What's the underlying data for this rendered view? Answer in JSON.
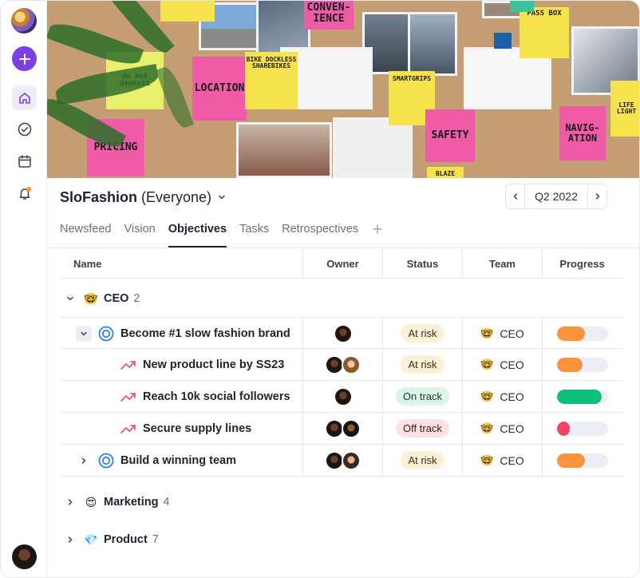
{
  "project": {
    "name": "SloFashion",
    "scope": "(Everyone)"
  },
  "period": {
    "label": "Q2 2022"
  },
  "tabs": [
    {
      "label": "Newsfeed"
    },
    {
      "label": "Vision"
    },
    {
      "label": "Objectives",
      "active": true
    },
    {
      "label": "Tasks"
    },
    {
      "label": "Retrospectives"
    }
  ],
  "cover_notes": {
    "convenience": "CONVEN-\nIENCE",
    "pass_box": "PASS BOX",
    "location": "LOCATION",
    "bike_docks": "BIKE DOCKLESS SHAREBIKES",
    "smartgrips": "SMARTGRIPS",
    "pricing": "PRICING",
    "safety": "SAFETY",
    "navigation": "NAVIG-\nATION",
    "do_not": "do not deposit",
    "life_light": "LIFE LIGHT",
    "blaze": "BLAZE"
  },
  "table": {
    "headers": {
      "name": "Name",
      "owner": "Owner",
      "status": "Status",
      "team": "Team",
      "progress": "Progress"
    },
    "groups": [
      {
        "emoji": "🤓",
        "name": "CEO",
        "count": "2",
        "expanded": true
      },
      {
        "emoji": "😍",
        "name": "Marketing",
        "count": "4",
        "expanded": false
      },
      {
        "emoji": "💎",
        "name": "Product",
        "count": "7",
        "expanded": false
      }
    ],
    "rows": [
      {
        "name": "Become #1 slow fashion brand",
        "kind": "goal",
        "status": "At risk",
        "team_emoji": "🤓",
        "team": "CEO",
        "progress": 0.55,
        "color": "#fb923c"
      },
      {
        "name": "New product line by SS23",
        "kind": "kr",
        "status": "At risk",
        "team_emoji": "🤓",
        "team": "CEO",
        "progress": 0.5,
        "color": "#fb923c"
      },
      {
        "name": "Reach 10k social followers",
        "kind": "kr",
        "status": "On track",
        "team_emoji": "🤓",
        "team": "CEO",
        "progress": 0.88,
        "color": "#10c07a"
      },
      {
        "name": "Secure supply lines",
        "kind": "kr",
        "status": "Off track",
        "team_emoji": "🤓",
        "team": "CEO",
        "progress": 0.25,
        "color": "#f04664"
      },
      {
        "name": "Build a winning team",
        "kind": "goal",
        "status": "At risk",
        "team_emoji": "🤓",
        "team": "CEO",
        "progress": 0.55,
        "color": "#fb923c"
      }
    ]
  },
  "colors": {
    "accent": "#7b3fe4",
    "goal_icon": "#2f7cf6",
    "kr_icon": "#f0508a"
  }
}
